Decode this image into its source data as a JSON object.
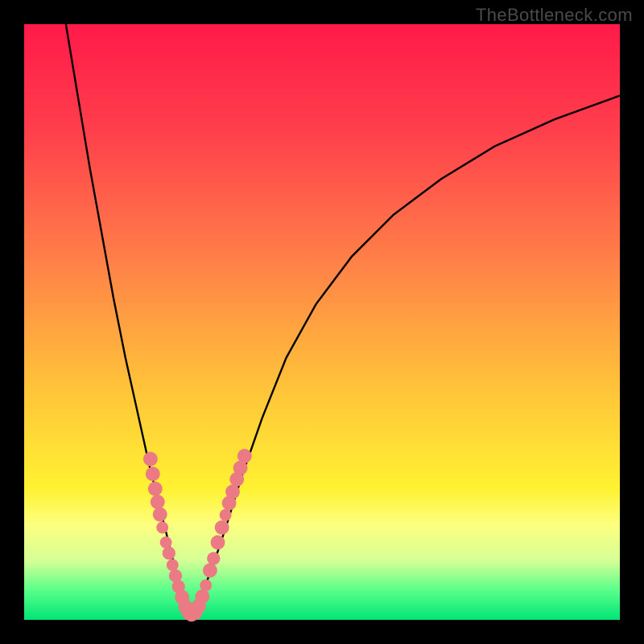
{
  "watermark": "TheBottleneck.com",
  "colors": {
    "gradient_top": "#ff1a49",
    "gradient_mid1": "#ff8148",
    "gradient_mid2": "#fff232",
    "gradient_bottom": "#00e576",
    "curve": "#000000",
    "dots": "#ec7a84",
    "frame": "#000000"
  },
  "chart_data": {
    "type": "line",
    "title": "",
    "xlabel": "",
    "ylabel": "",
    "xlim": [
      0,
      100
    ],
    "ylim": [
      0,
      100
    ],
    "grid": false,
    "legend": null,
    "series": [
      {
        "name": "left-branch",
        "x": [
          7,
          9,
          11,
          13,
          15,
          17,
          19,
          21,
          22.5,
          24,
          25,
          26,
          27,
          27.8
        ],
        "y": [
          100,
          88,
          76,
          65,
          54,
          44,
          35,
          26,
          20,
          14,
          10,
          6.5,
          3.5,
          1
        ]
      },
      {
        "name": "right-branch",
        "x": [
          27.8,
          29,
          30.5,
          32,
          34,
          36.5,
          40,
          44,
          49,
          55,
          62,
          70,
          79,
          89,
          100
        ],
        "y": [
          1,
          3,
          6,
          10,
          16,
          24,
          34,
          44,
          53,
          61,
          68,
          74,
          79.5,
          84,
          88
        ]
      }
    ],
    "markers": [
      {
        "x": 21.2,
        "y": 27.0,
        "r": 1.2
      },
      {
        "x": 21.6,
        "y": 24.5,
        "r": 1.2
      },
      {
        "x": 22.0,
        "y": 22.0,
        "r": 1.2
      },
      {
        "x": 22.4,
        "y": 19.8,
        "r": 1.2
      },
      {
        "x": 22.8,
        "y": 17.7,
        "r": 1.2
      },
      {
        "x": 23.2,
        "y": 15.5,
        "r": 1.0
      },
      {
        "x": 23.8,
        "y": 13.0,
        "r": 1.0
      },
      {
        "x": 24.3,
        "y": 11.2,
        "r": 1.1
      },
      {
        "x": 24.9,
        "y": 9.2,
        "r": 1.0
      },
      {
        "x": 25.4,
        "y": 7.4,
        "r": 1.1
      },
      {
        "x": 25.9,
        "y": 5.6,
        "r": 1.1
      },
      {
        "x": 26.5,
        "y": 3.8,
        "r": 1.2
      },
      {
        "x": 27.1,
        "y": 2.2,
        "r": 1.2
      },
      {
        "x": 27.6,
        "y": 1.2,
        "r": 1.2
      },
      {
        "x": 28.1,
        "y": 0.9,
        "r": 1.2
      },
      {
        "x": 28.7,
        "y": 1.2,
        "r": 1.2
      },
      {
        "x": 29.3,
        "y": 2.3,
        "r": 1.2
      },
      {
        "x": 29.9,
        "y": 3.9,
        "r": 1.2
      },
      {
        "x": 30.5,
        "y": 5.8,
        "r": 1.0
      },
      {
        "x": 31.2,
        "y": 8.3,
        "r": 1.2
      },
      {
        "x": 31.8,
        "y": 10.3,
        "r": 1.1
      },
      {
        "x": 32.5,
        "y": 13.0,
        "r": 1.2
      },
      {
        "x": 33.2,
        "y": 15.5,
        "r": 1.2
      },
      {
        "x": 33.8,
        "y": 17.6,
        "r": 1.0
      },
      {
        "x": 34.4,
        "y": 19.6,
        "r": 1.2
      },
      {
        "x": 35.0,
        "y": 21.5,
        "r": 1.2
      },
      {
        "x": 35.7,
        "y": 23.6,
        "r": 1.2
      },
      {
        "x": 36.3,
        "y": 25.5,
        "r": 1.2
      },
      {
        "x": 37.0,
        "y": 27.5,
        "r": 1.2
      }
    ]
  }
}
